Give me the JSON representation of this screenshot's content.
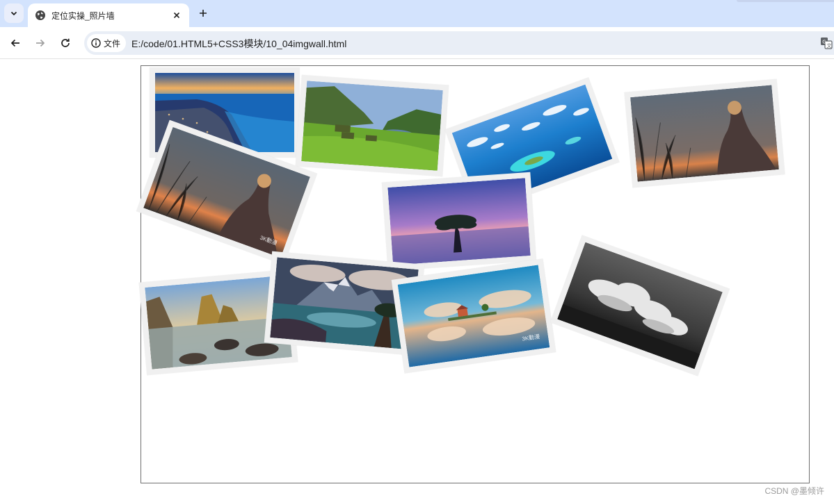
{
  "browser": {
    "tab_title": "定位实操_照片墙",
    "site_info_label": "文件",
    "url": "E:/code/01.HTML5+CSS3模块/10_04imgwall.html"
  },
  "photo_wall": {
    "photos": [
      {
        "subject": "coastal-city-sunset",
        "watermark": ""
      },
      {
        "subject": "green-valley-turf-houses",
        "watermark": ""
      },
      {
        "subject": "tropical-island-aerial",
        "watermark": ""
      },
      {
        "subject": "girl-in-wheat-field-right",
        "watermark": ""
      },
      {
        "subject": "girl-in-wheat-field-left",
        "watermark": "3K動漫"
      },
      {
        "subject": "lone-tree-purple-lake",
        "watermark": ""
      },
      {
        "subject": "sea-stacks-rocky-shore",
        "watermark": ""
      },
      {
        "subject": "fantasy-mountain-lake",
        "watermark": ""
      },
      {
        "subject": "house-on-islet-reflection",
        "watermark": "3K動漫"
      },
      {
        "subject": "black-white-clouds",
        "watermark": ""
      }
    ]
  },
  "page_watermark": "CSDN @墨倾许"
}
